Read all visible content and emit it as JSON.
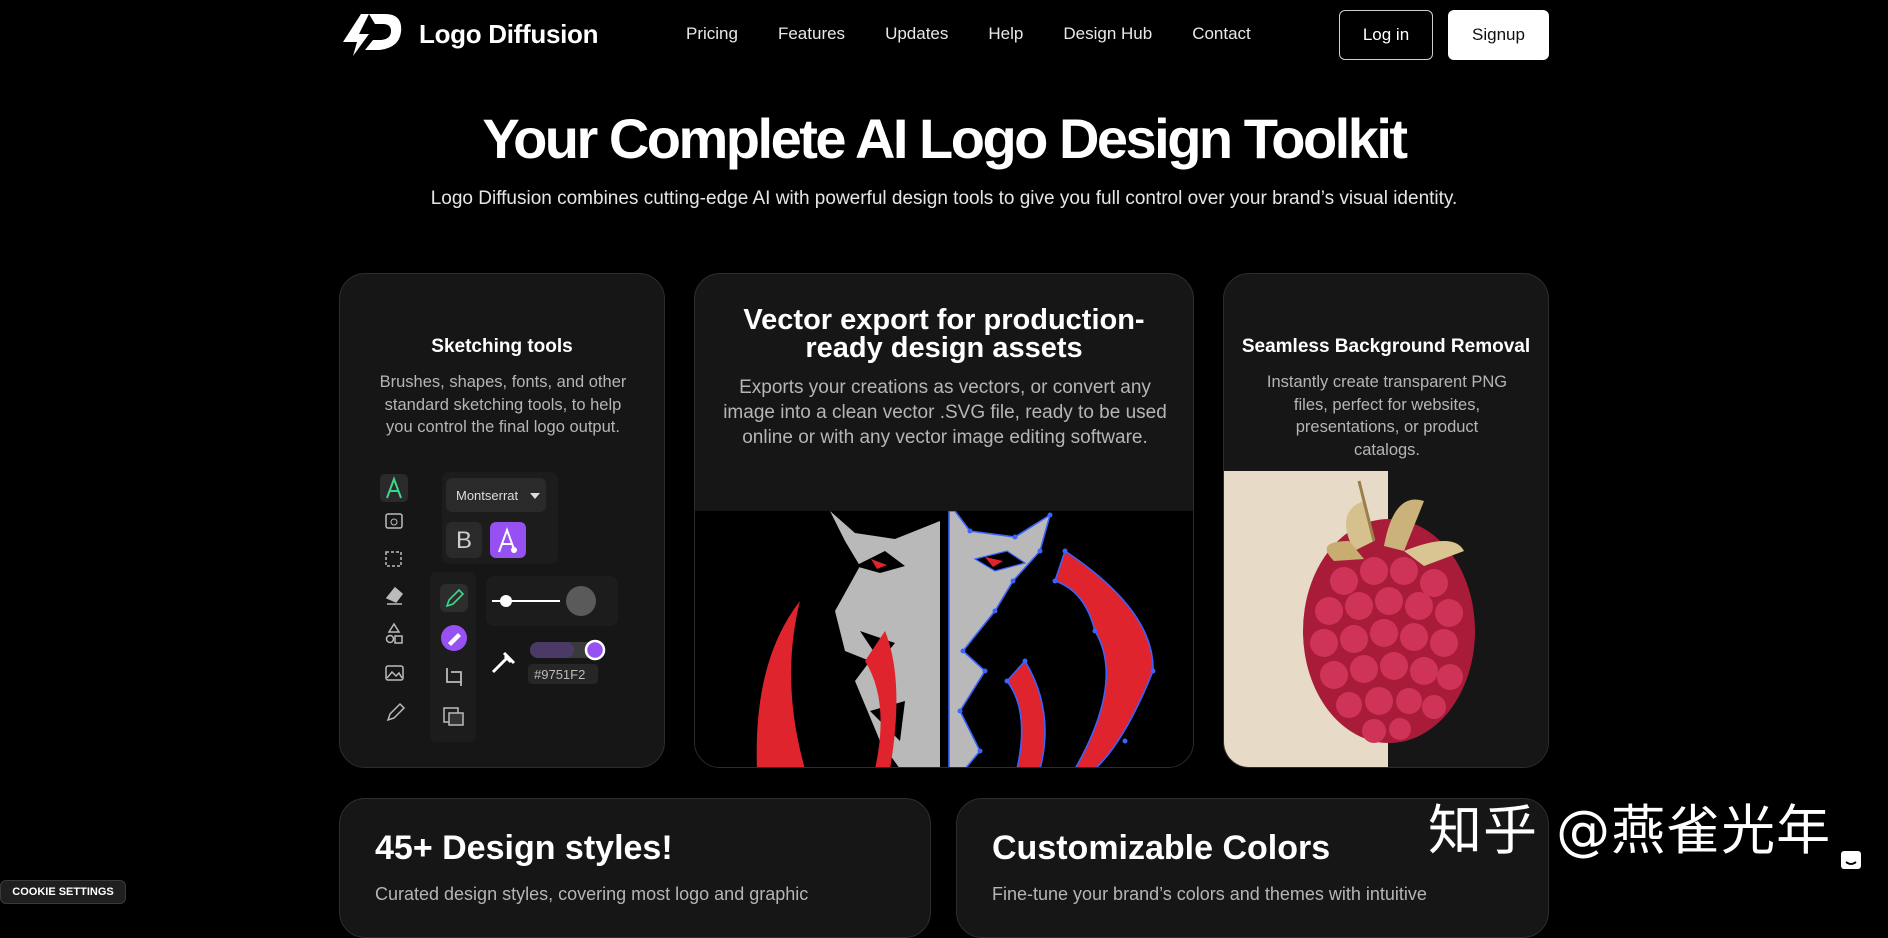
{
  "brand": {
    "name": "Logo Diffusion"
  },
  "nav": {
    "items": [
      "Pricing",
      "Features",
      "Updates",
      "Help",
      "Design Hub",
      "Contact"
    ],
    "login": "Log in",
    "signup": "Signup"
  },
  "hero": {
    "title": "Your Complete AI Logo Design Toolkit",
    "subtitle": "Logo Diffusion combines cutting-edge AI with powerful design tools to give you full control over your brand’s visual identity."
  },
  "cards": {
    "sketching": {
      "title": "Sketching tools",
      "desc": "Brushes, shapes, fonts, and other standard sketching tools, to help you control the final logo output.",
      "font_name": "Montserrat",
      "bold_label": "B",
      "color_hex": "#9751F2"
    },
    "vector": {
      "title": "Vector export for production-ready design assets",
      "desc": "Exports your creations as vectors, or convert any image into a clean vector .SVG file, ready to be used online or with any vector image editing software."
    },
    "bg_removal": {
      "title": "Seamless Background Removal",
      "desc": "Instantly create transparent PNG files, perfect for websites, presentations, or product catalogs."
    },
    "styles": {
      "title": "45+ Design styles!",
      "desc": "Curated design styles, covering most logo and graphic"
    },
    "colors": {
      "title": "Customizable Colors",
      "desc": "Fine-tune your brand’s colors and themes with intuitive"
    }
  },
  "cookie": {
    "label": "COOKIE SETTINGS"
  },
  "watermark": {
    "text": "知乎 @燕雀光年"
  },
  "colors": {
    "accent": "#9751F2",
    "green": "#39d98a",
    "lion_red": "#e0242d"
  }
}
